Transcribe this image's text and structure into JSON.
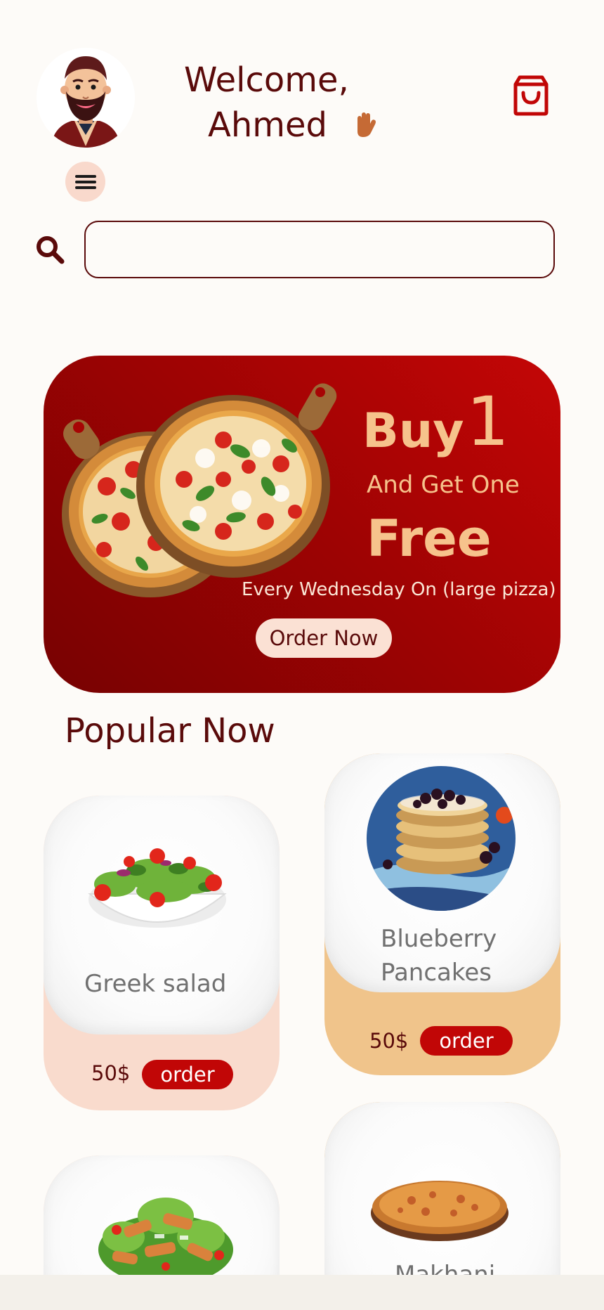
{
  "header": {
    "greeting": "Welcome,",
    "user_name": "Ahmed",
    "wave_icon": "waving-hand-icon",
    "cart_icon": "shopping-bag-icon",
    "menu_icon": "hamburger-menu-icon",
    "avatar_icon": "bearded-man-avatar"
  },
  "search": {
    "icon": "search-icon",
    "value": "",
    "placeholder": ""
  },
  "promo": {
    "buy": "Buy",
    "number": "1",
    "get": "And Get One",
    "free": "Free",
    "schedule": "Every Wednesday On (large pizza)",
    "button": "Order Now"
  },
  "popular": {
    "title": "Popular Now",
    "items": [
      {
        "name": "Greek salad",
        "price": "50$",
        "order_label": "order"
      },
      {
        "name": "Blueberry Pancakes",
        "price": "50$",
        "order_label": "order"
      },
      {
        "name": "",
        "price": "",
        "order_label": ""
      },
      {
        "name": "Makhani",
        "price": "",
        "order_label": ""
      }
    ]
  },
  "colors": {
    "primary": "#5a0a0a",
    "accent_red": "#c10606",
    "peach": "#f9dbcd",
    "sand": "#f0c48b",
    "promo_text": "#f6c38c",
    "background": "#fdfbf8"
  }
}
